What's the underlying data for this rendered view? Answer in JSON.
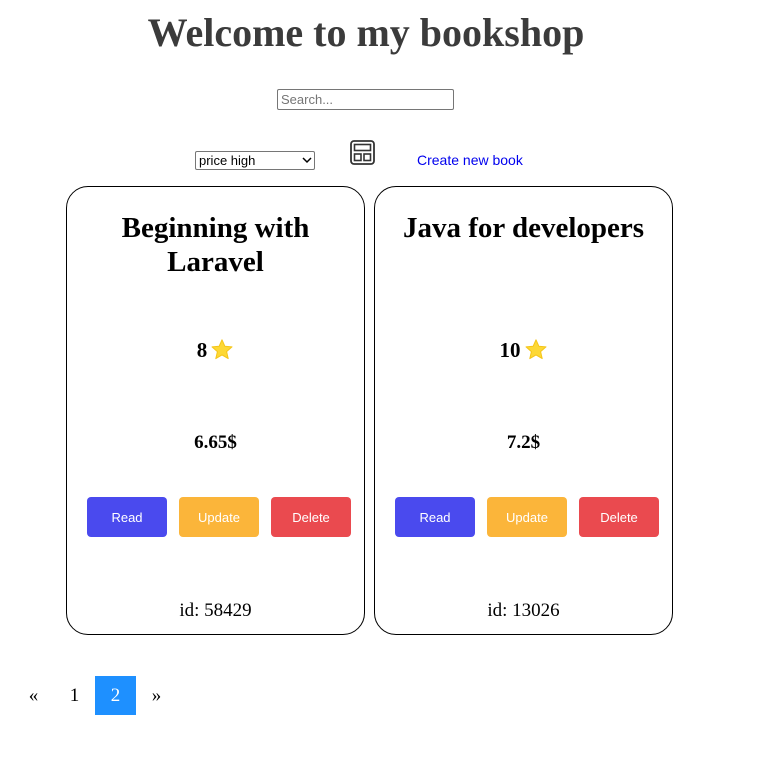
{
  "header": {
    "title": "Welcome to my bookshop"
  },
  "search": {
    "placeholder": "Search...",
    "value": ""
  },
  "toolbar": {
    "sort_value": "price high",
    "layout_icon": "layout-grid-icon",
    "create_link": "Create new book"
  },
  "books": [
    {
      "title": "Beginning with Laravel",
      "rating": "8",
      "price": "6.65$",
      "id_text": "id: 58429",
      "read_label": "Read",
      "update_label": "Update",
      "delete_label": "Delete"
    },
    {
      "title": "Java for developers",
      "rating": "10",
      "price": "7.2$",
      "id_text": "id: 13026",
      "read_label": "Read",
      "update_label": "Update",
      "delete_label": "Delete"
    }
  ],
  "pagination": {
    "prev": "«",
    "pages": [
      "1",
      "2"
    ],
    "current": "2",
    "next": "»"
  },
  "colors": {
    "read": "#4a4aee",
    "update": "#fbb53a",
    "delete": "#ea4a4f",
    "active_page": "#1e90ff",
    "star": "#fdd835",
    "link": "#0000ee"
  }
}
